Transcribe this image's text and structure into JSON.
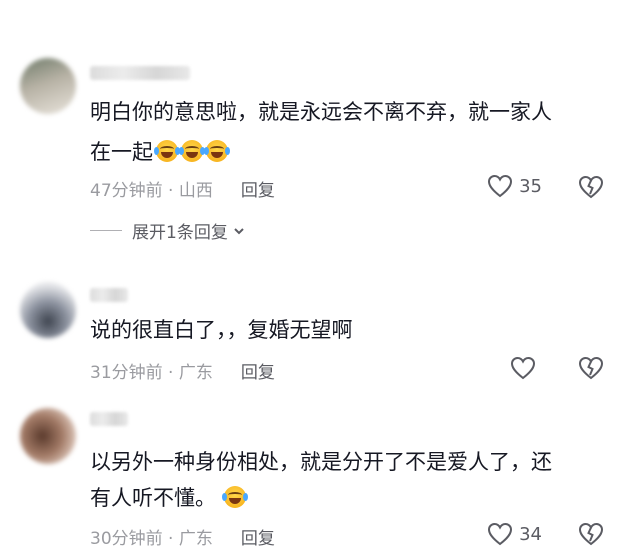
{
  "comments": [
    {
      "text_line1": "明白你的意思啦，就是永远会不离不弃，就一家人",
      "text_line2": "在一起",
      "time": "47分钟前",
      "location": "山西",
      "reply_label": "回复",
      "likes": "35",
      "expand_label": "展开1条回复"
    },
    {
      "text_line1": "说的很直白了，，复婚无望啊",
      "time": "31分钟前",
      "location": "广东",
      "reply_label": "回复",
      "likes": ""
    },
    {
      "text_line1": "以另外一种身份相处，就是分开了不是爱人了，还",
      "text_line2": "有人听不懂。",
      "time": "30分钟前",
      "location": "广东",
      "reply_label": "回复",
      "likes": "34"
    }
  ],
  "meta_separator": " · ",
  "icons": {
    "like": "heart-outline-icon",
    "dislike": "broken-heart-outline-icon",
    "expand": "chevron-down-icon",
    "emoji": "crying-laughing-emoji-icon"
  },
  "colors": {
    "text": "#161823",
    "meta": "#9a9ba0",
    "action": "#5b5c63"
  }
}
